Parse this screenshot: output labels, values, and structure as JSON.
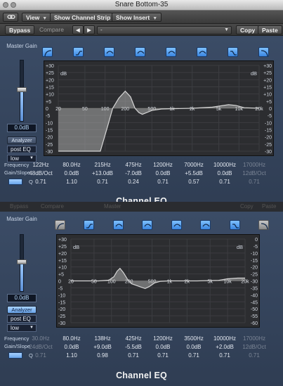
{
  "window": {
    "title": "Snare Bottom-35"
  },
  "toolbar": {
    "view": "View",
    "show_channel_strip": "Show Channel Strip",
    "show_insert": "Show Insert",
    "bypass": "Bypass",
    "compare": "Compare",
    "prev": "◀",
    "next": "▶",
    "preset": "-",
    "copy": "Copy",
    "paste": "Paste"
  },
  "background_strip": [
    "Bypass",
    "Compare",
    "Master",
    "Copy",
    "Paste"
  ],
  "panels": [
    {
      "master_gain_label": "Master Gain",
      "master_gain_value": "0.0dB",
      "master_gain_level": 0.5,
      "analyzer": "Analyzer",
      "analyzer_active": false,
      "analyzer_mode": "post EQ",
      "resolution": "low",
      "gain_unit": "dB",
      "left_scale": [
        "+30",
        "+25",
        "+20",
        "+15",
        "+10",
        "+5",
        "0",
        "-5",
        "-10",
        "-15",
        "-20",
        "-25",
        "-30"
      ],
      "right_scale": [
        "+30",
        "+25",
        "+20",
        "+15",
        "+10",
        "+5",
        "0",
        "-5",
        "-10",
        "-15",
        "-20",
        "-25",
        "-30"
      ],
      "freq_ticks": [
        "20",
        "50",
        "100",
        "200",
        "500",
        "1k",
        "2k",
        "5k",
        "10k",
        "20k"
      ],
      "freq_ticks_hz": [
        20,
        50,
        100,
        200,
        500,
        1000,
        2000,
        5000,
        10000,
        20000
      ],
      "curve": [
        [
          20,
          -30
        ],
        [
          40,
          -30
        ],
        [
          60,
          -30
        ],
        [
          85,
          -30
        ],
        [
          110,
          -12
        ],
        [
          130,
          0
        ],
        [
          160,
          7
        ],
        [
          200,
          12
        ],
        [
          240,
          8
        ],
        [
          280,
          0
        ],
        [
          320,
          -3
        ],
        [
          360,
          -4.2
        ],
        [
          420,
          -3
        ],
        [
          500,
          -1.5
        ],
        [
          700,
          -0.5
        ],
        [
          1000,
          -0.3
        ],
        [
          2000,
          0
        ],
        [
          4000,
          0.8
        ],
        [
          7000,
          2.5
        ],
        [
          9000,
          2
        ],
        [
          12000,
          0.4
        ],
        [
          20000,
          0
        ]
      ],
      "curve_color": "#a9a9a9",
      "bands_on": [
        true,
        true,
        true,
        true,
        true,
        true,
        true,
        true
      ],
      "freq_label": "Frequency",
      "gainslope_label": "Gain/Slope",
      "q_label": "Q",
      "frequencies": [
        "122Hz",
        "80.0Hz",
        "215Hz",
        "475Hz",
        "1200Hz",
        "7000Hz",
        "10000Hz",
        "17000Hz"
      ],
      "gains": [
        "48dB/Oct",
        "0.0dB",
        "+13.0dB",
        "-7.0dB",
        "0.0dB",
        "+5.5dB",
        "0.0dB",
        "12dB/Oct"
      ],
      "qs": [
        "0.71",
        "1.10",
        "0.71",
        "0.24",
        "0.71",
        "0.57",
        "0.71",
        "0.71"
      ],
      "dimmed_columns": [
        7
      ],
      "plugin_name": "Channel EQ"
    },
    {
      "master_gain_label": "Master Gain",
      "master_gain_value": "0.0dB",
      "master_gain_level": 0.5,
      "analyzer": "Analyzer",
      "analyzer_active": true,
      "analyzer_mode": "post EQ",
      "resolution": "low",
      "gain_unit": "dB",
      "left_scale": [
        "+30",
        "+25",
        "+20",
        "+15",
        "+10",
        "+5",
        "0",
        "-5",
        "-10",
        "-15",
        "-20",
        "-25",
        "-30"
      ],
      "right_scale": [
        "0",
        "-5",
        "-10",
        "-15",
        "-20",
        "-25",
        "-30",
        "-35",
        "-40",
        "-45",
        "-50",
        "-55",
        "-60"
      ],
      "freq_ticks": [
        "20",
        "50",
        "100",
        "200",
        "500",
        "1k",
        "2k",
        "5k",
        "10k",
        "20k"
      ],
      "freq_ticks_hz": [
        20,
        50,
        100,
        200,
        500,
        1000,
        2000,
        5000,
        10000,
        20000
      ],
      "curve": [
        [
          20,
          0
        ],
        [
          60,
          0
        ],
        [
          90,
          0.5
        ],
        [
          110,
          3
        ],
        [
          125,
          7
        ],
        [
          140,
          9
        ],
        [
          160,
          6
        ],
        [
          190,
          1
        ],
        [
          220,
          -2
        ],
        [
          300,
          -4
        ],
        [
          380,
          -5.5
        ],
        [
          450,
          -4
        ],
        [
          550,
          -1.5
        ],
        [
          700,
          -0.3
        ],
        [
          1000,
          0
        ],
        [
          3000,
          0
        ],
        [
          7000,
          0.4
        ],
        [
          10000,
          1.5
        ],
        [
          15000,
          2
        ],
        [
          20000,
          2
        ]
      ],
      "curve_color": "#a9a9a9",
      "bands_on": [
        false,
        true,
        true,
        true,
        true,
        true,
        true,
        false
      ],
      "freq_label": "Frequency",
      "gainslope_label": "Gain/Slope",
      "q_label": "Q",
      "frequencies": [
        "30.0Hz",
        "80.0Hz",
        "138Hz",
        "425Hz",
        "1200Hz",
        "3500Hz",
        "10000Hz",
        "17000Hz"
      ],
      "gains": [
        "24dB/Oct",
        "0.0dB",
        "+9.0dB",
        "-5.5dB",
        "0.0dB",
        "0.0dB",
        "+2.0dB",
        "12dB/Oct"
      ],
      "qs": [
        "0.71",
        "1.10",
        "0.98",
        "0.71",
        "0.71",
        "0.71",
        "0.71",
        "0.71"
      ],
      "dimmed_columns": [
        0,
        7
      ],
      "plugin_name": "Channel EQ"
    }
  ],
  "colors": {
    "band_on": "#5aa6f2",
    "band_off": "#a8a8a8",
    "panel": "#34445d",
    "graph_bg": "#2c2d30"
  }
}
